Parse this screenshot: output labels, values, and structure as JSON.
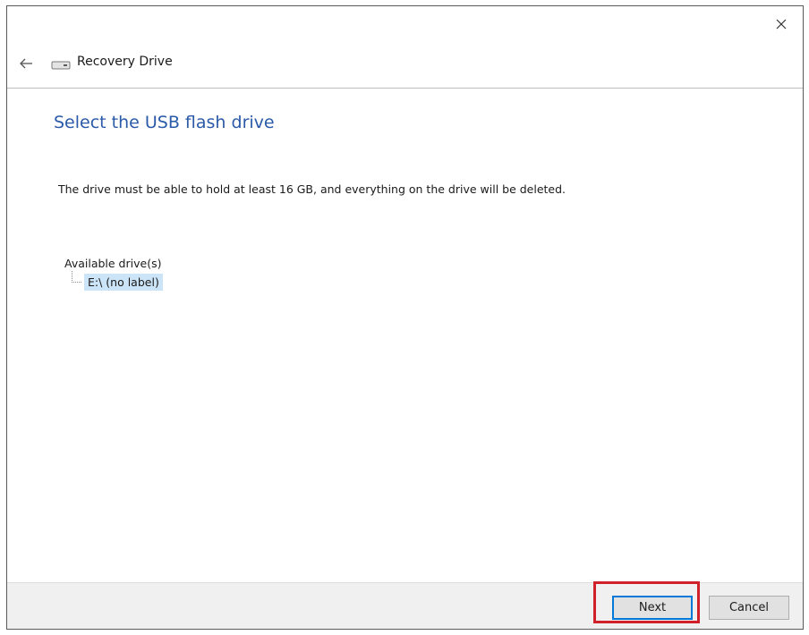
{
  "window": {
    "title": "Recovery Drive"
  },
  "page": {
    "title": "Select the USB flash drive",
    "description": "The drive must be able to hold at least 16 GB, and everything on the drive will be deleted."
  },
  "drives": {
    "label": "Available drive(s)",
    "items": [
      {
        "label": "E:\\ (no label)",
        "selected": true
      }
    ]
  },
  "footer": {
    "next_label": "Next",
    "cancel_label": "Cancel"
  },
  "icons": {
    "close": "close-icon",
    "back": "back-arrow-icon",
    "drive": "drive-icon"
  },
  "colors": {
    "title_blue": "#2a5aa8",
    "selection": "#cce4f7",
    "highlight_red": "#d0202a",
    "default_button_border": "#0078d7"
  }
}
